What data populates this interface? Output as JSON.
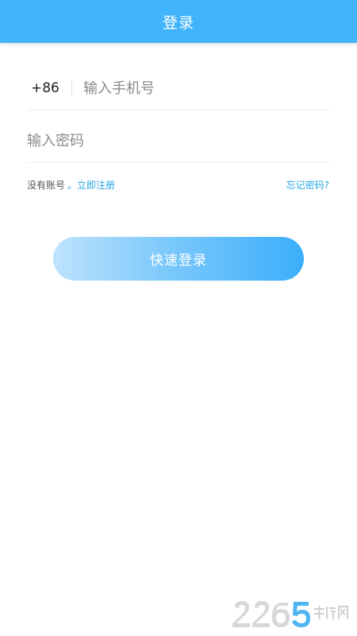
{
  "header": {
    "title": "登录"
  },
  "form": {
    "country_code": "+86",
    "phone_placeholder": "输入手机号",
    "password_placeholder": "输入密码"
  },
  "links": {
    "no_account": "没有账号",
    "register": "。立即注册",
    "forgot_password": "忘记密码?"
  },
  "actions": {
    "login_button": "快速登录"
  },
  "watermark": {
    "brand": "2265手游网"
  },
  "colors": {
    "header_bg": "#42b4fb",
    "link": "#2aa6e6",
    "button_gradient_start": "#bfe3fd",
    "button_gradient_end": "#3aaefb"
  }
}
